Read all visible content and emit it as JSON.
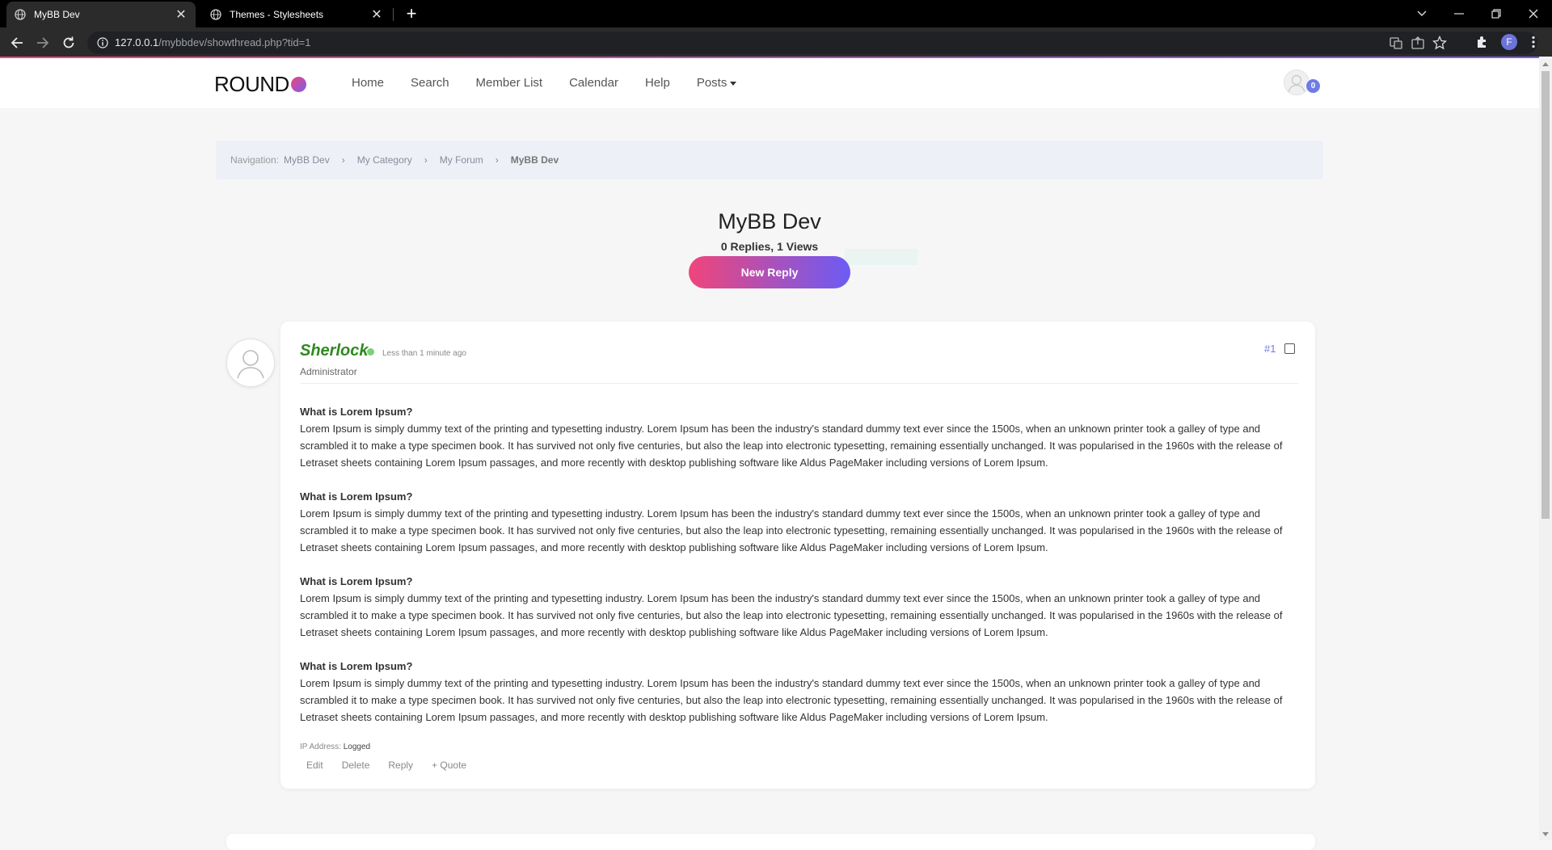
{
  "browser": {
    "tabs": [
      {
        "title": "MyBB Dev",
        "active": true
      },
      {
        "title": "Themes - Stylesheets",
        "active": false
      }
    ],
    "url_host": "127.0.0.1",
    "url_path": "/mybbdev/showthread.php?tid=1",
    "profile_initial": "F"
  },
  "header": {
    "logo": "ROUND",
    "nav": [
      "Home",
      "Search",
      "Member List",
      "Calendar",
      "Help",
      "Posts"
    ],
    "notification_count": "0"
  },
  "breadcrumb": {
    "label": "Navigation:",
    "items": [
      "MyBB Dev",
      "My Category",
      "My Forum"
    ],
    "current": "MyBB Dev",
    "separator": "›"
  },
  "thread": {
    "title": "MyBB Dev",
    "stats": "0 Replies, 1 Views",
    "new_reply_label": "New Reply"
  },
  "post": {
    "author": "Sherlock",
    "time": "Less than 1 minute ago",
    "role": "Administrator",
    "number": "#1",
    "paragraphs": [
      {
        "heading": "What is Lorem Ipsum?",
        "text": "Lorem Ipsum is simply dummy text of the printing and typesetting industry. Lorem Ipsum has been the industry's standard dummy text ever since the 1500s, when an unknown printer took a galley of type and scrambled it to make a type specimen book. It has survived not only five centuries, but also the leap into electronic typesetting, remaining essentially unchanged. It was popularised in the 1960s with the release of Letraset sheets containing Lorem Ipsum passages, and more recently with desktop publishing software like Aldus PageMaker including versions of Lorem Ipsum."
      },
      {
        "heading": "What is Lorem Ipsum?",
        "text": "Lorem Ipsum is simply dummy text of the printing and typesetting industry. Lorem Ipsum has been the industry's standard dummy text ever since the 1500s, when an unknown printer took a galley of type and scrambled it to make a type specimen book. It has survived not only five centuries, but also the leap into electronic typesetting, remaining essentially unchanged. It was popularised in the 1960s with the release of Letraset sheets containing Lorem Ipsum passages, and more recently with desktop publishing software like Aldus PageMaker including versions of Lorem Ipsum."
      },
      {
        "heading": "What is Lorem Ipsum?",
        "text": "Lorem Ipsum is simply dummy text of the printing and typesetting industry. Lorem Ipsum has been the industry's standard dummy text ever since the 1500s, when an unknown printer took a galley of type and scrambled it to make a type specimen book. It has survived not only five centuries, but also the leap into electronic typesetting, remaining essentially unchanged. It was popularised in the 1960s with the release of Letraset sheets containing Lorem Ipsum passages, and more recently with desktop publishing software like Aldus PageMaker including versions of Lorem Ipsum."
      },
      {
        "heading": "What is Lorem Ipsum?",
        "text": "Lorem Ipsum is simply dummy text of the printing and typesetting industry. Lorem Ipsum has been the industry's standard dummy text ever since the 1500s, when an unknown printer took a galley of type and scrambled it to make a type specimen book. It has survived not only five centuries, but also the leap into electronic typesetting, remaining essentially unchanged. It was popularised in the 1960s with the release of Letraset sheets containing Lorem Ipsum passages, and more recently with desktop publishing software like Aldus PageMaker including versions of Lorem Ipsum."
      }
    ],
    "ip_label": "IP Address:",
    "ip_value": "Logged",
    "actions": [
      "Edit",
      "Delete",
      "Reply",
      "+ Quote"
    ]
  },
  "colors": {
    "accent_start": "#f0457a",
    "accent_end": "#6b5cf5",
    "author_online": "#2f8a1f",
    "link_blue": "#6f7ce6"
  }
}
